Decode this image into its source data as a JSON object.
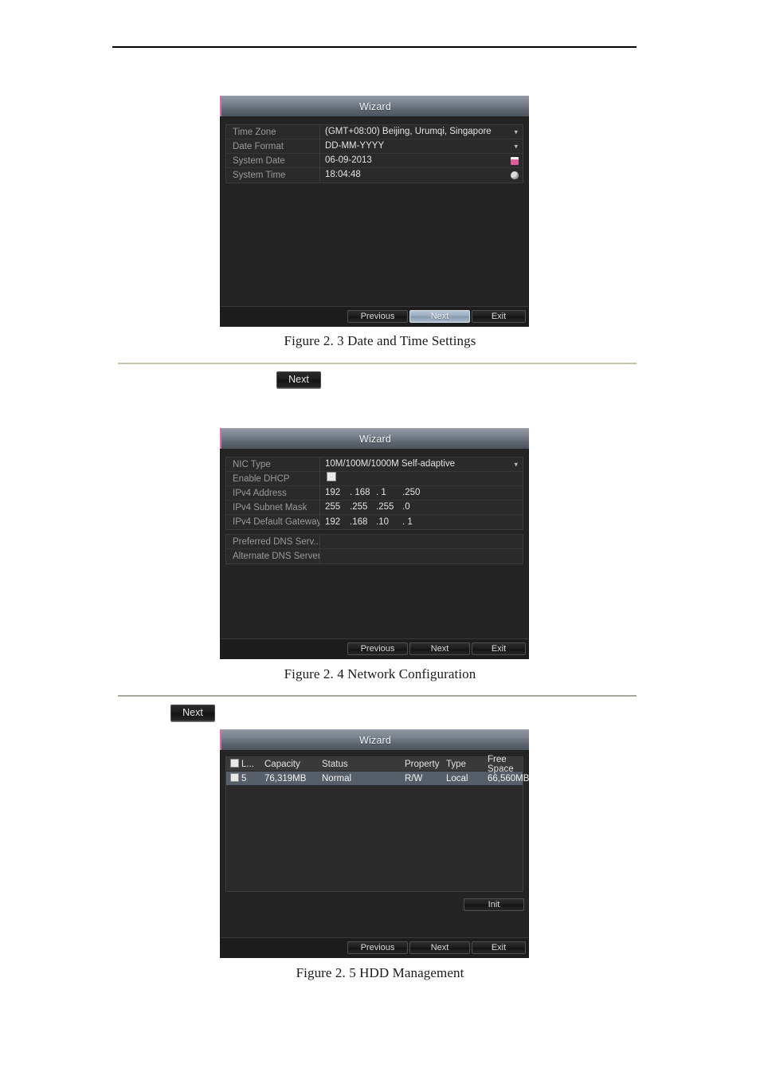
{
  "document": {
    "captions": {
      "fig_2_3": "Figure 2. 3 Date and Time Settings",
      "fig_2_4": "Figure 2. 4 Network Configuration",
      "fig_2_5": "Figure 2. 5 HDD Management"
    },
    "inline_buttons": {
      "next_1": "Next",
      "next_2": "Next"
    }
  },
  "wizard_datetime": {
    "title": "Wizard",
    "fields": [
      {
        "label": "Time Zone",
        "value": "(GMT+08:00) Beijing, Urumqi, Singapore",
        "control": "chevron-down-icon"
      },
      {
        "label": "Date Format",
        "value": "DD-MM-YYYY",
        "control": "chevron-down-icon"
      },
      {
        "label": "System Date",
        "value": "06-09-2013",
        "control": "calendar-icon"
      },
      {
        "label": "System Time",
        "value": "18:04:48",
        "control": "clock-icon"
      }
    ],
    "buttons": {
      "previous": "Previous",
      "next": "Next",
      "exit": "Exit"
    },
    "focused_button": "next"
  },
  "wizard_network": {
    "title": "Wizard",
    "nic_type": {
      "label": "NIC Type",
      "value": "10M/100M/1000M Self-adaptive",
      "control": "chevron-down-icon"
    },
    "enable_dhcp": {
      "label": "Enable DHCP",
      "checked": false
    },
    "ipv4_address": {
      "label": "IPv4 Address",
      "octets": [
        "192",
        "168",
        "1",
        "250"
      ]
    },
    "ipv4_subnet_mask": {
      "label": "IPv4 Subnet Mask",
      "octets": [
        "255",
        "255",
        "255",
        "0"
      ]
    },
    "ipv4_default_gateway": {
      "label": "IPv4 Default Gateway",
      "octets": [
        "192",
        "168",
        "10",
        "1"
      ]
    },
    "preferred_dns": {
      "label": "Preferred DNS Serv...",
      "value": ""
    },
    "alternate_dns": {
      "label": "Alternate DNS Server",
      "value": ""
    },
    "buttons": {
      "previous": "Previous",
      "next": "Next",
      "exit": "Exit"
    }
  },
  "wizard_hdd": {
    "title": "Wizard",
    "columns": [
      "L...",
      "Capacity",
      "Status",
      "Property",
      "Type",
      "Free Space"
    ],
    "rows": [
      {
        "label": "5",
        "capacity": "76,319MB",
        "status": "Normal",
        "property": "R/W",
        "type": "Local",
        "free_space": "66,560MB",
        "selected": true
      }
    ],
    "init_button": "Init",
    "buttons": {
      "previous": "Previous",
      "next": "Next",
      "exit": "Exit"
    }
  },
  "theme": {
    "dialog_bg": "#242424",
    "titlebar_accent": "#d66ba8",
    "row_selected": "#565f69",
    "focus_button": "#97a9bd",
    "caption_color": "#1a1a1a",
    "rule_beige": "#c8c0a8",
    "rule_gray": "#a8a89e"
  }
}
